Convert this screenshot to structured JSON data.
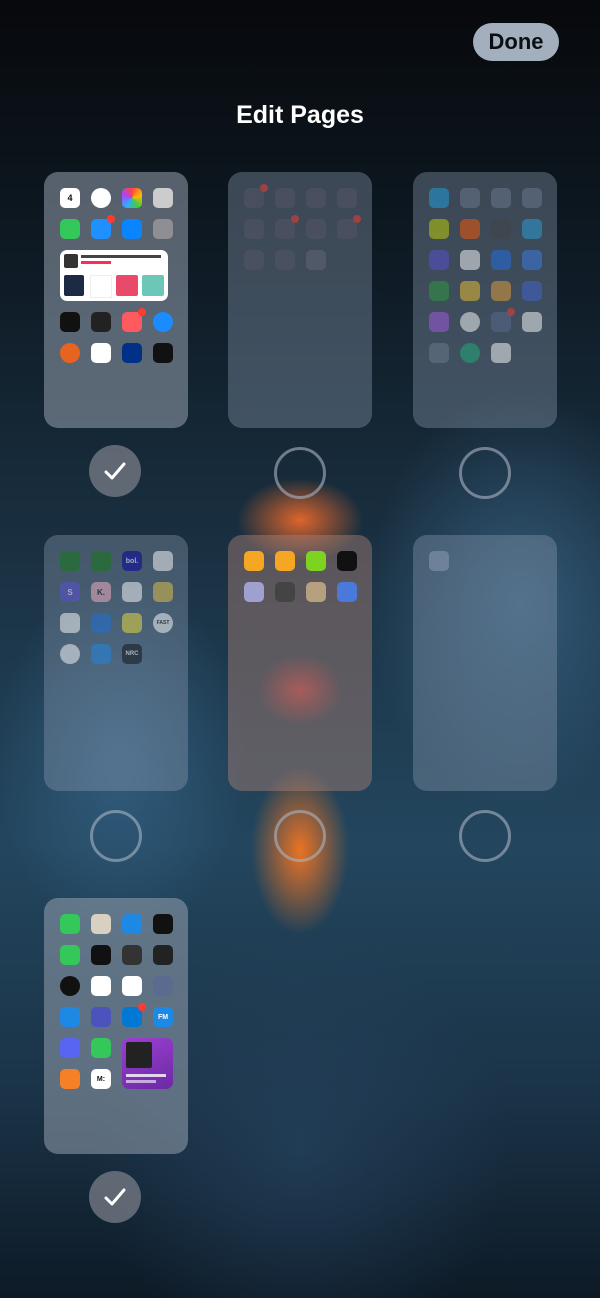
{
  "header": {
    "done_label": "Done",
    "title": "Edit Pages"
  },
  "widget_text": {
    "music_title": "Classic Idols Presents: Wake Your Min...",
    "music_sub": "Cosmic Sabe",
    "year": "'20"
  },
  "icon_text": {
    "calendar_day": "4",
    "bol": "bol.",
    "scribd": "S",
    "klarna": "K.",
    "fast": "FAST",
    "nrc": "NRC",
    "fm": "FM",
    "podcast": "TE LTM LEFT\nFeel The Panic",
    "medium": "M:"
  },
  "colors": {
    "checked": "#7c7f87",
    "accent_done_bg": "#bfcddb"
  },
  "pages": [
    {
      "name": "page-1",
      "selected": true
    },
    {
      "name": "page-2",
      "selected": false
    },
    {
      "name": "page-3",
      "selected": false
    },
    {
      "name": "page-4",
      "selected": false
    },
    {
      "name": "page-5",
      "selected": false
    },
    {
      "name": "page-6",
      "selected": false
    },
    {
      "name": "page-7",
      "selected": true
    }
  ]
}
